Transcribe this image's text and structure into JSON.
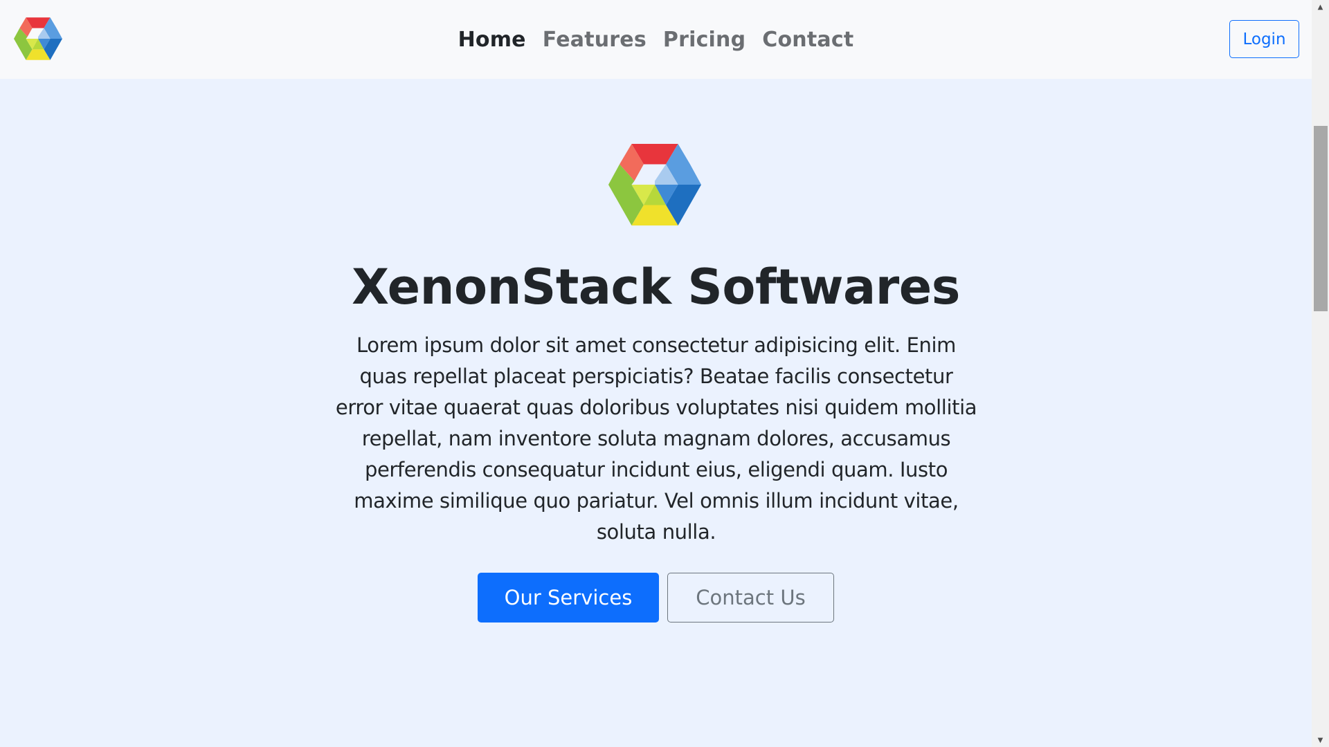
{
  "nav": {
    "logo_icon": "hexagon-logo-icon",
    "links": [
      {
        "label": "Home",
        "active": true
      },
      {
        "label": "Features",
        "active": false
      },
      {
        "label": "Pricing",
        "active": false
      },
      {
        "label": "Contact",
        "active": false
      }
    ],
    "login_label": "Login"
  },
  "hero": {
    "logo_icon": "hexagon-logo-icon",
    "title": "XenonStack Softwares",
    "text": "Lorem ipsum dolor sit amet consectetur adipisicing elit. Enim quas repellat placeat perspiciatis? Beatae facilis consectetur error vitae quaerat quas doloribus voluptates nisi quidem mollitia repellat, nam inventore soluta magnam dolores, accusamus perferendis consequatur incidunt eius, eligendi quam. Iusto maxime similique quo pariatur. Vel omnis illum incidunt vitae, soluta nulla.",
    "primary_button": "Our Services",
    "secondary_button": "Contact Us"
  },
  "scrollbar": {
    "up_icon": "scroll-up-arrow-icon",
    "down_icon": "scroll-down-arrow-icon"
  },
  "colors": {
    "accent": "#0d6efd",
    "page_background": "#ebf2fe",
    "navbar_background": "#f8f9fb",
    "text_dark": "#212529",
    "nav_muted": "#6b6e72",
    "secondary": "#6c757d",
    "logo_red": "#e8353c",
    "logo_blue": "#2f7fd0",
    "logo_green": "#8cc63f",
    "logo_yellow": "#f0e12b"
  }
}
